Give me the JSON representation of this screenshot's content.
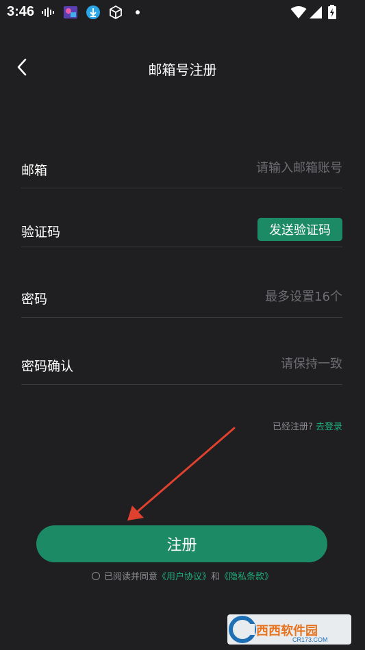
{
  "status_bar": {
    "time": "3:46",
    "icons": [
      "audio-wave-icon",
      "app-thumbnail-icon",
      "download-icon",
      "cube-icon",
      "dot-icon",
      "wifi-icon",
      "signal-icon",
      "battery-charging-icon"
    ]
  },
  "header": {
    "title": "邮箱号注册",
    "back_icon": "chevron-left-icon"
  },
  "form": {
    "email": {
      "label": "邮箱",
      "placeholder": "请输入邮箱账号"
    },
    "code": {
      "label": "验证码",
      "button": "发送验证码"
    },
    "password": {
      "label": "密码",
      "placeholder": "最多设置16个"
    },
    "confirm": {
      "label": "密码确认",
      "placeholder": "请保持一致"
    }
  },
  "login_hint": {
    "text": "已经注册?",
    "link": "去登录"
  },
  "register_button": "注册",
  "agreement": {
    "prefix": "已阅读并同意",
    "user_agreement": "《用户协议》",
    "and": "和",
    "privacy": "《隐私条款》"
  },
  "watermark": {
    "brand": "西西软件园",
    "domain": "CR173.COM"
  },
  "colors": {
    "accent": "#1c8a64",
    "link": "#1fae7b",
    "background": "#1f1f21",
    "annotation_arrow": "#e0412f"
  }
}
